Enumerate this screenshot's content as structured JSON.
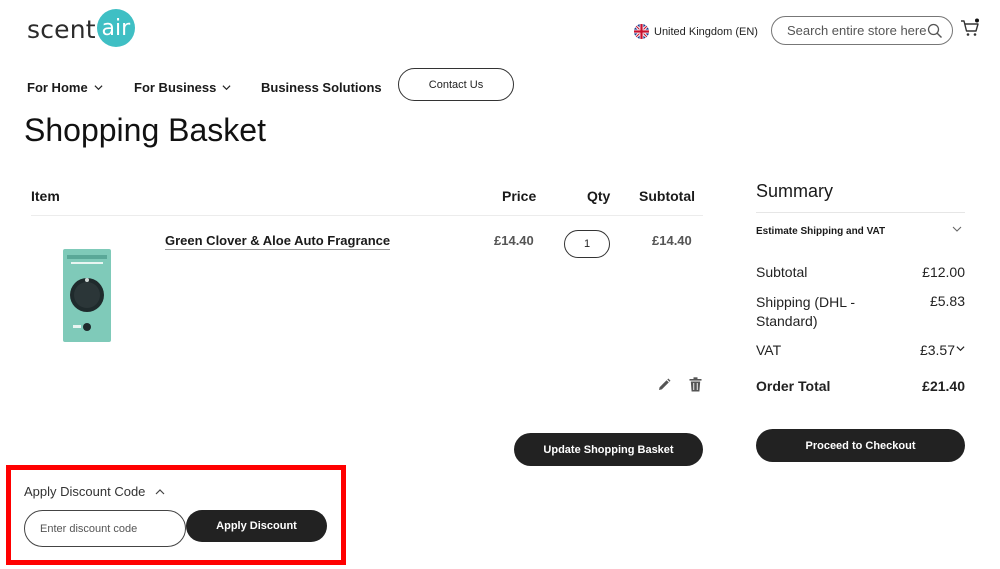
{
  "header": {
    "logo_prefix": "scent",
    "logo_bubble": "air",
    "locale_label": "United Kingdom (EN)",
    "search_placeholder": "Search entire store here...",
    "brand_color": "#3fbfc4"
  },
  "nav": {
    "items": [
      {
        "label": "For Home",
        "has_dropdown": true
      },
      {
        "label": "For Business",
        "has_dropdown": true
      },
      {
        "label": "Business Solutions",
        "has_dropdown": false
      }
    ],
    "contact_label": "Contact Us"
  },
  "page": {
    "title": "Shopping Basket"
  },
  "basket": {
    "headers": {
      "item": "Item",
      "price": "Price",
      "qty": "Qty",
      "subtotal": "Subtotal"
    },
    "items": [
      {
        "name": "Green Clover & Aloe Auto Fragrance",
        "price": "£14.40",
        "qty": "1",
        "subtotal": "£14.40"
      }
    ],
    "update_label": "Update Shopping Basket"
  },
  "summary": {
    "title": "Summary",
    "estimate_label": "Estimate Shipping and VAT",
    "rows": [
      {
        "label": "Subtotal",
        "value": "£12.00"
      },
      {
        "label": "Shipping (DHL - Standard)",
        "value": "£5.83"
      },
      {
        "label": "VAT",
        "value": "£3.57"
      },
      {
        "label": "Order Total",
        "value": "£21.40"
      }
    ],
    "checkout_label": "Proceed to Checkout"
  },
  "discount": {
    "title": "Apply Discount Code",
    "placeholder": "Enter discount code",
    "apply_label": "Apply Discount",
    "highlight_color": "#ff0000"
  },
  "icons": [
    "uk-flag-icon",
    "search-icon",
    "cart-icon",
    "chevron-down-icon",
    "edit-icon",
    "trash-icon",
    "chevron-up-icon"
  ]
}
